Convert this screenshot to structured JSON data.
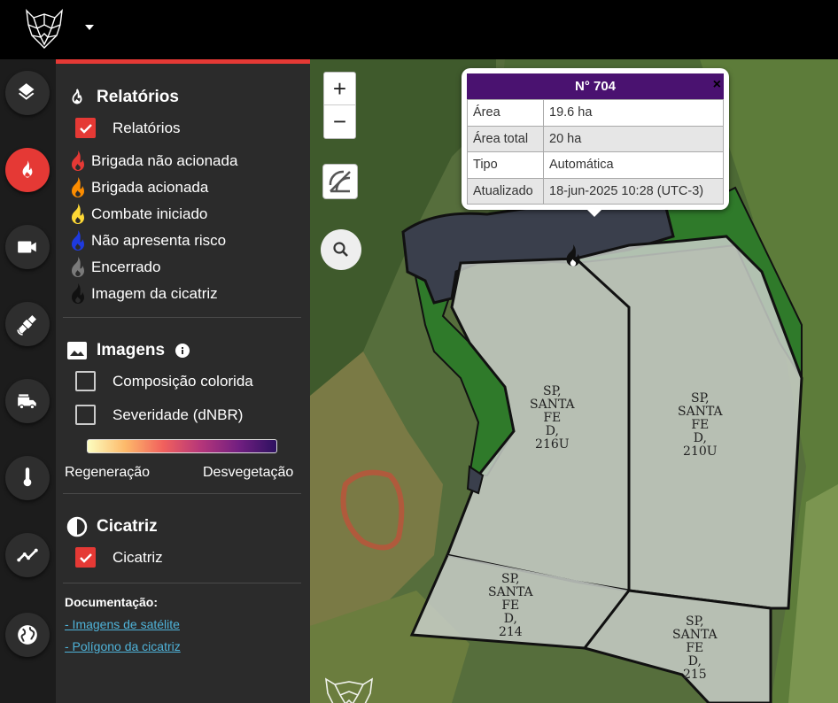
{
  "sidebar_panel": {
    "relatorios": {
      "title": "Relatórios",
      "checkbox_label": "Relatórios",
      "legend": [
        {
          "label": "Brigada não acionada",
          "color": "#e53935"
        },
        {
          "label": "Brigada acionada",
          "color": "#fb8c00"
        },
        {
          "label": "Combate iniciado",
          "color": "#fdd835"
        },
        {
          "label": "Não apresenta risco",
          "color": "#1e3adf"
        },
        {
          "label": "Encerrado",
          "color": "#7a7a7a"
        },
        {
          "label": "Imagem da cicatriz",
          "color": "#111111"
        }
      ]
    },
    "imagens": {
      "title": "Imagens",
      "option1": "Composição colorida",
      "option2": "Severidade (dNBR)",
      "gradient_left": "Regeneração",
      "gradient_right": "Desvegetação"
    },
    "cicatriz": {
      "title": "Cicatriz",
      "checkbox_label": "Cicatriz"
    },
    "docs": {
      "title": "Documentação:",
      "link1": "- Imagens de satélite",
      "link2": "- Polígono da cicatriz"
    }
  },
  "map": {
    "zoom_in": "+",
    "zoom_out": "−",
    "popup": {
      "title": "N° 704",
      "close": "×",
      "rows": [
        {
          "key": "Área",
          "value": "19.6 ha"
        },
        {
          "key": "Área total",
          "value": "20 ha"
        },
        {
          "key": "Tipo",
          "value": "Automática"
        },
        {
          "key": "Atualizado",
          "value": "18-jun-2025 10:28 (UTC-3)"
        }
      ]
    },
    "field_labels": {
      "f216u": "SP,\nSANTA\nFE\nD,\n216U",
      "f210u": "SP,\nSANTA\nFE\nD,\n210U",
      "f214": "SP,\nSANTA\nFE\nD,\n214",
      "f215": "SP,\nSANTA\nFE\nD,\n215"
    }
  }
}
